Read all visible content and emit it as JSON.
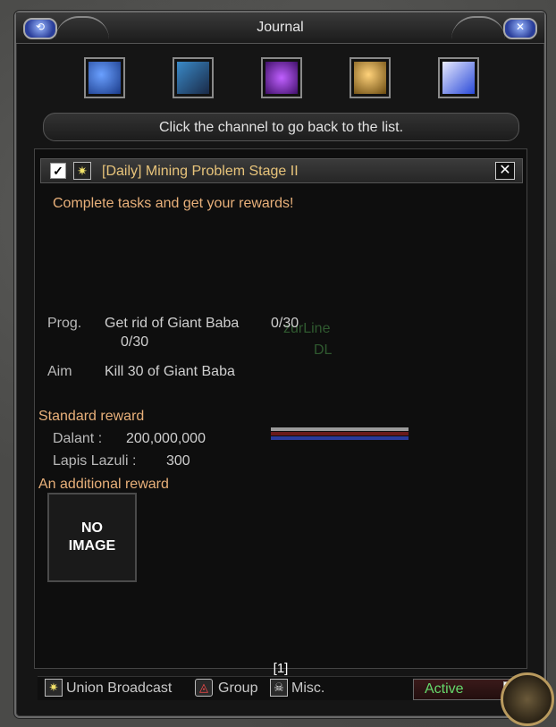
{
  "window": {
    "title": "Journal"
  },
  "title_orbs": {
    "left": "⟲",
    "right": "✕"
  },
  "channels": [
    {
      "name": "satellite-channel-icon",
      "color": "#2a5ab8"
    },
    {
      "name": "npc-chat-channel-icon",
      "color": "#2a8ab8"
    },
    {
      "name": "purple-gem-channel-icon",
      "color": "#8a2ab8"
    },
    {
      "name": "golden-orb-channel-icon",
      "color": "#c89a2a"
    },
    {
      "name": "book-channel-icon",
      "color": "#3a5ad8"
    }
  ],
  "hint": "Click the channel to go back to the list.",
  "quest": {
    "checked": "✓",
    "title": "[Daily] Mining Problem Stage II",
    "close": "✕",
    "description": "Complete tasks and get your rewards!",
    "progress": {
      "label": "Prog.",
      "task": "Get rid of Giant Baba",
      "count1": "0/30",
      "count2": "0/30"
    },
    "aim": {
      "label": "Aim",
      "text": "Kill 30 of Giant Baba"
    },
    "standard_reward": {
      "label": "Standard reward",
      "items": [
        {
          "name": "Dalant :",
          "value": "200,000,000"
        },
        {
          "name": "Lapis Lazuli :",
          "value": "300"
        }
      ]
    },
    "additional_reward": {
      "label": "An additional reward",
      "image_text_1": "NO",
      "image_text_2": "IMAGE"
    },
    "page": "[1]"
  },
  "background_overlay": {
    "name1": "zurLine",
    "name2": "DL"
  },
  "footer": {
    "union": "Union Broadcast",
    "group": "Group",
    "misc": "Misc.",
    "active": "Active",
    "active_checked": "✓"
  }
}
